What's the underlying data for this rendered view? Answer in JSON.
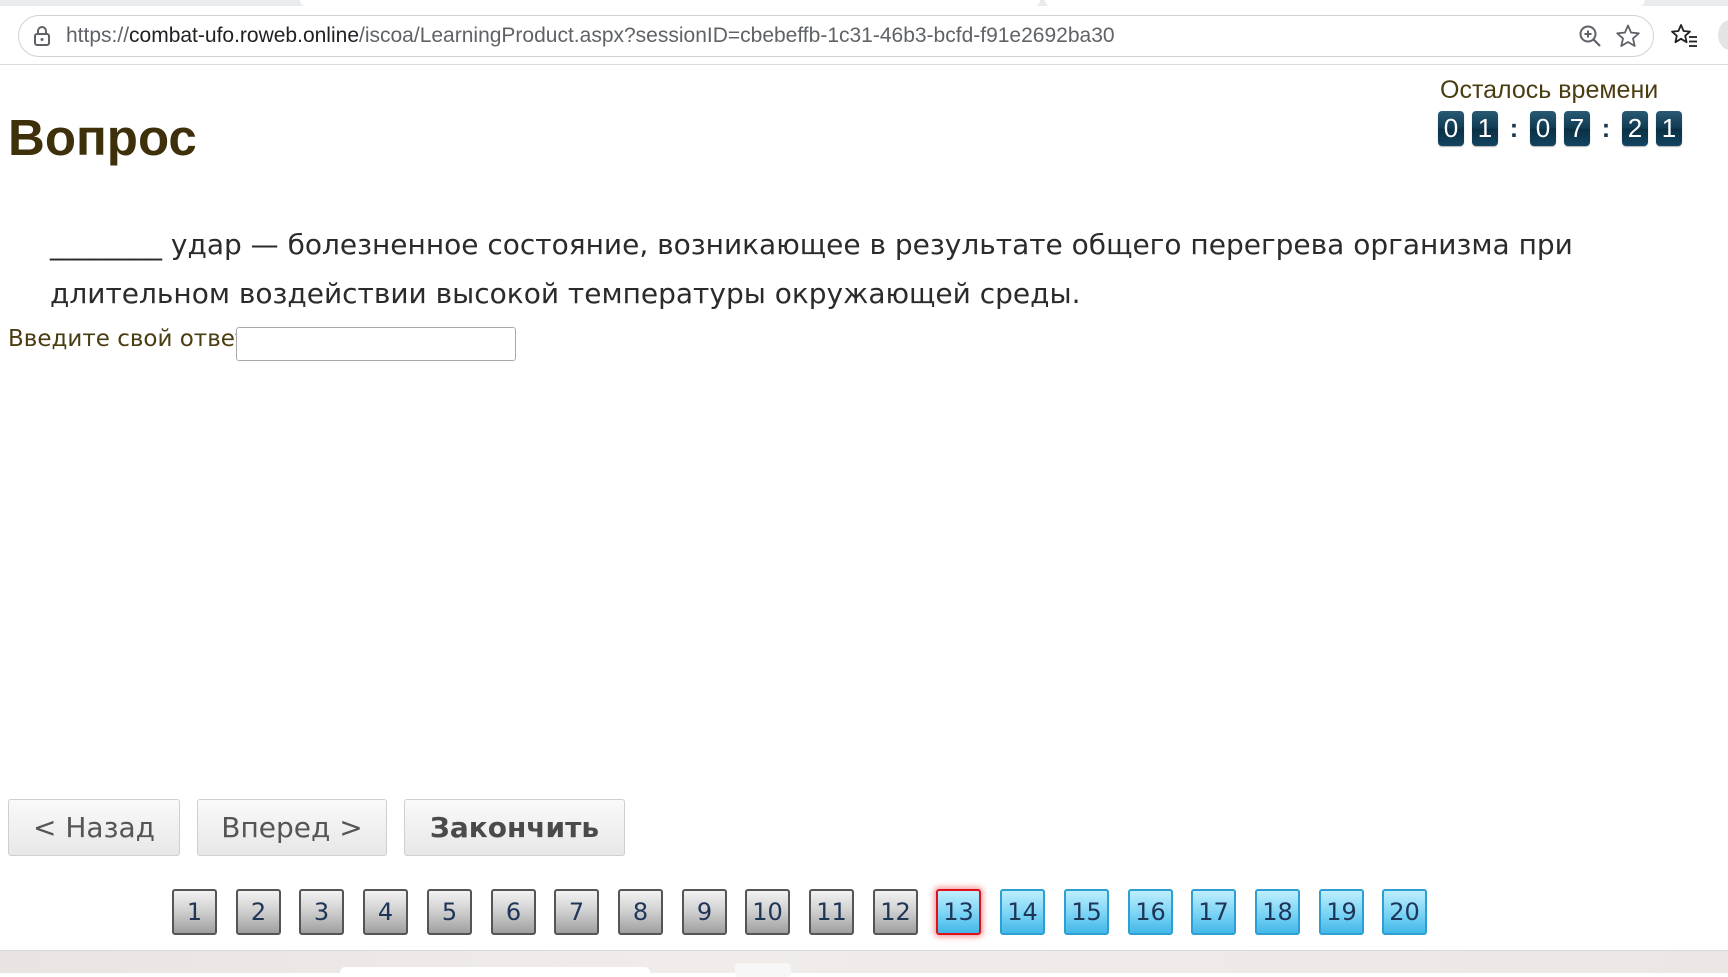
{
  "browser": {
    "url_prefix": "https://",
    "url_domain": "combat-ufo.roweb.online",
    "url_path": "/iscoa/LearningProduct.aspx?sessionID=cbebeffb-1c31-46b3-bcfd-f91e2692ba30",
    "icons": [
      "lock-icon",
      "zoom-icon",
      "star-icon",
      "favorites-icon"
    ]
  },
  "timer": {
    "label": "Осталось времени",
    "digits": [
      "0",
      "1",
      "0",
      "7",
      "2",
      "1"
    ],
    "separator": ":"
  },
  "page": {
    "title": "Вопрос",
    "question": "________ удар — болезненное состояние, возникающее в результате общего перегрева организма при длительном воздействии высокой температуры окружающей среды.",
    "answer_label": "Введите свой ответ",
    "answer_value": ""
  },
  "buttons": {
    "back": "< Назад",
    "next": "Вперед >",
    "finish": "Закончить"
  },
  "question_nav": {
    "numbers": [
      "1",
      "2",
      "3",
      "4",
      "5",
      "6",
      "7",
      "8",
      "9",
      "10",
      "11",
      "12",
      "13",
      "14",
      "15",
      "16",
      "17",
      "18",
      "19",
      "20"
    ],
    "answered_through": 12,
    "current": 13
  },
  "colors": {
    "title": "#3f300c",
    "answered": "#9f9f9f",
    "unanswered": "#43b8e8",
    "current_border": "#e0101a",
    "timer_digit": "#0f3a52"
  }
}
